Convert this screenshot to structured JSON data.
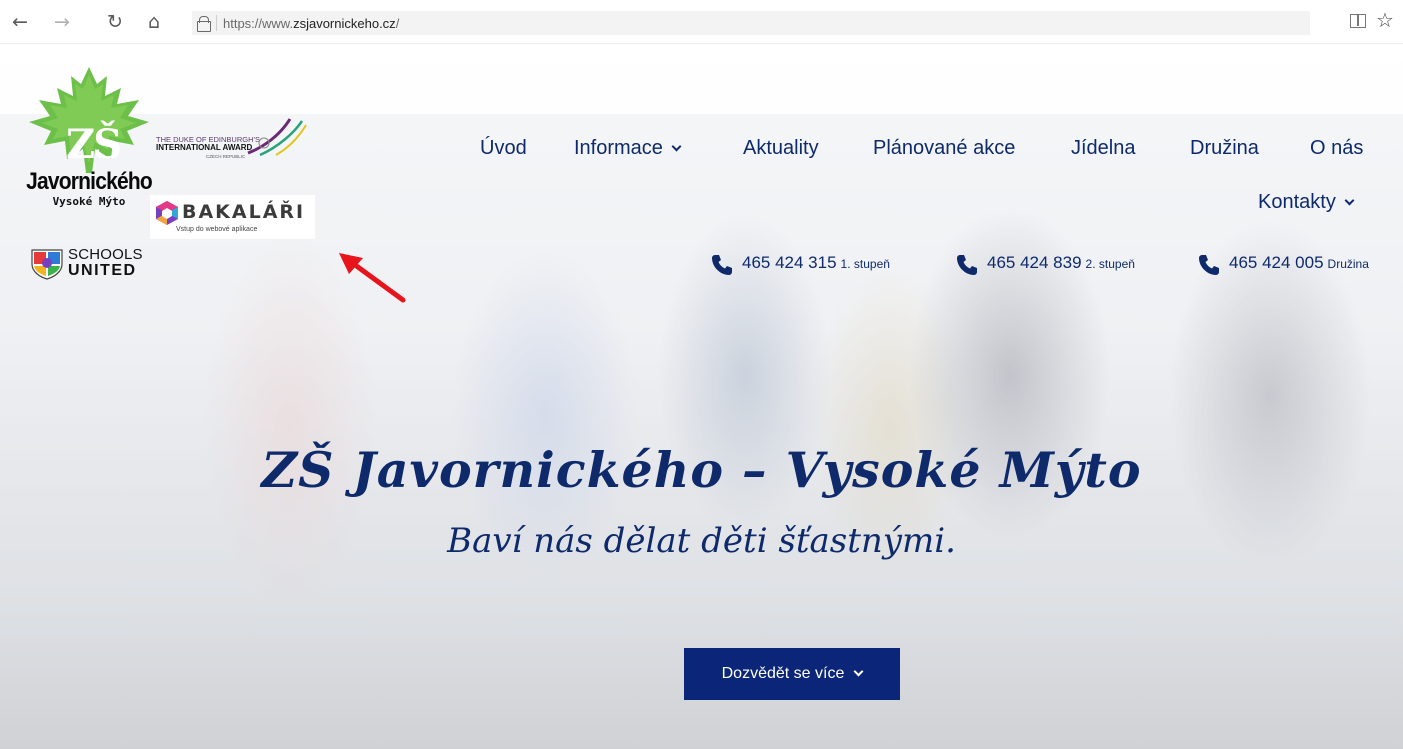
{
  "browser": {
    "url_prefix": "https://www.",
    "url_host": "zsjavornickeho.cz",
    "url_suffix": "/",
    "back_icon": "←",
    "forward_icon": "→",
    "refresh_icon": "↻",
    "home_icon": "⌂",
    "favorite_icon": "☆"
  },
  "logos": {
    "school_initials": "ZŠ",
    "school_name": "Javornického",
    "school_town": "Vysoké Mýto",
    "duke_line1": "THE DUKE OF EDINBURGH'S",
    "duke_line2": "INTERNATIONAL AWARD",
    "duke_line3": "CZECH REPUBLIC",
    "bakalari_name": "BAKALÁŘI",
    "bakalari_sub": "Vstup do webové aplikace",
    "schools_united_line1": "SCHOOLS",
    "schools_united_line2": "UNITED"
  },
  "nav": {
    "uvod": "Úvod",
    "informace": "Informace",
    "aktuality": "Aktuality",
    "planovane_akce": "Plánované akce",
    "jidelna": "Jídelna",
    "druzina": "Družina",
    "o_nas": "O nás",
    "kontakty": "Kontakty"
  },
  "phones": [
    {
      "number": "465 424 315",
      "label": "1. stupeň"
    },
    {
      "number": "465 424 839",
      "label": "2. stupeň"
    },
    {
      "number": "465 424 005",
      "label": "Družina"
    }
  ],
  "hero": {
    "title": "ZŠ Javornického – Vysoké Mýto",
    "subtitle": "Baví nás dělat děti šťastnými.",
    "cta_label": "Dozvědět se více"
  },
  "colors": {
    "brand_navy": "#0e2a6b",
    "button_bg": "#0b2678",
    "leaf_green": "#6cc04a",
    "annotation_arrow": "#e8141c"
  }
}
